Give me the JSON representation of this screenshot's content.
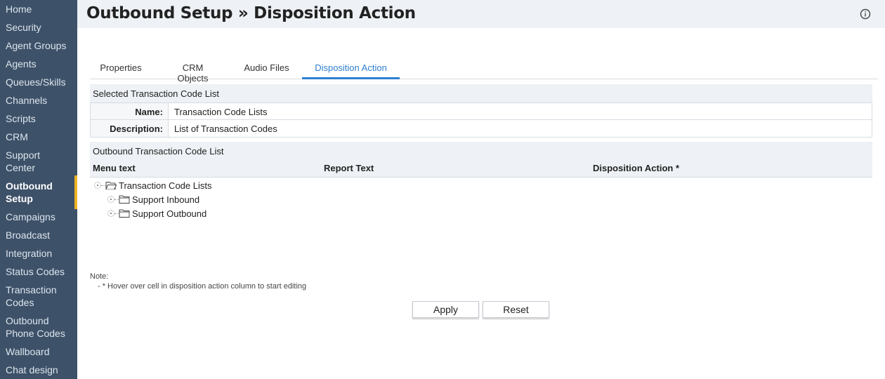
{
  "sidebar": {
    "items": [
      {
        "label": "Home"
      },
      {
        "label": "Security"
      },
      {
        "label": "Agent Groups"
      },
      {
        "label": "Agents"
      },
      {
        "label": "Queues/Skills"
      },
      {
        "label": "Channels"
      },
      {
        "label": "Scripts"
      },
      {
        "label": "CRM"
      },
      {
        "label": "Support",
        "label2": "Center"
      },
      {
        "label": "Outbound",
        "label2": "Setup",
        "active": true
      },
      {
        "label": "Campaigns"
      },
      {
        "label": "Broadcast"
      },
      {
        "label": "Integration"
      },
      {
        "label": "Status Codes"
      },
      {
        "label": "Transaction",
        "label2": "Codes"
      },
      {
        "label": "Outbound",
        "label2": "Phone Codes"
      },
      {
        "label": "Wallboard"
      },
      {
        "label": "Chat design"
      }
    ],
    "active_accent": "#f0b323",
    "background": "#3d5168"
  },
  "header": {
    "title": "Outbound Setup » Disposition Action",
    "info_icon": "info-icon"
  },
  "tabs": [
    {
      "label": "Properties",
      "active": false
    },
    {
      "label": "CRM Objects",
      "active": false
    },
    {
      "label": "Audio Files",
      "active": false
    },
    {
      "label": "Disposition Action",
      "active": true
    }
  ],
  "selected_list": {
    "section_title": "Selected Transaction Code List",
    "name_label": "Name:",
    "name_value": "Transaction Code Lists",
    "description_label": "Description:",
    "description_value": "List of Transaction Codes"
  },
  "outbound_list": {
    "section_title": "Outbound Transaction Code List",
    "columns": [
      "Menu text",
      "Report Text",
      "Disposition Action *"
    ],
    "tree": {
      "root": "Transaction Code Lists",
      "children": [
        "Support Inbound",
        "Support Outbound"
      ]
    }
  },
  "note": {
    "title": "Note:",
    "line": "- * Hover over cell in disposition action column to start editing"
  },
  "actions": {
    "apply_label": "Apply",
    "reset_label": "Reset"
  },
  "colors": {
    "accent": "#2e7fd1",
    "header_bg": "#eef1f5"
  }
}
